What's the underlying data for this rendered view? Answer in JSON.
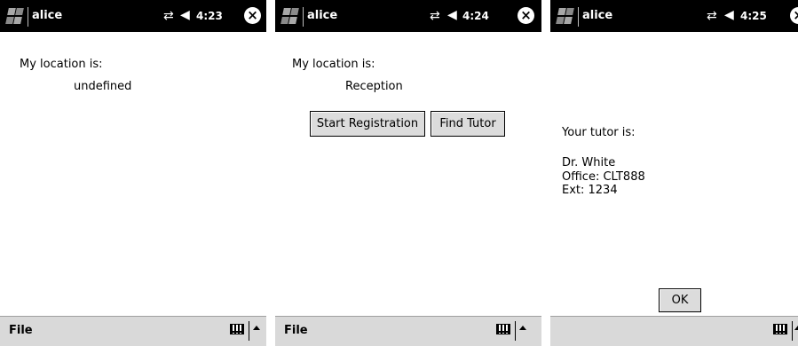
{
  "colors": {
    "titlebar": "#000000",
    "menubar": "#d9d9d9",
    "button_face": "#dcdcdc"
  },
  "screens": [
    {
      "titlebar": {
        "app_title": "alice",
        "time": "4:23",
        "icons": [
          "windows-logo-icon",
          "connectivity-icon",
          "speaker-icon",
          "close-icon"
        ]
      },
      "content": {
        "location_label": "My location is:",
        "location_value": "undefined"
      },
      "menubar": {
        "file_label": "File",
        "icons": [
          "keyboard-icon",
          "arrow-up-icon"
        ]
      }
    },
    {
      "titlebar": {
        "app_title": "alice",
        "time": "4:24",
        "icons": [
          "windows-logo-icon",
          "connectivity-icon",
          "speaker-icon",
          "close-icon"
        ]
      },
      "content": {
        "location_label": "My location is:",
        "location_value": "Reception",
        "start_registration_label": "Start Registration",
        "find_tutor_label": "Find Tutor"
      },
      "menubar": {
        "file_label": "File",
        "icons": [
          "keyboard-icon",
          "arrow-up-icon"
        ]
      }
    },
    {
      "titlebar": {
        "app_title": "alice",
        "time": "4:25",
        "icons": [
          "windows-logo-icon",
          "connectivity-icon",
          "speaker-icon",
          "close-icon"
        ]
      },
      "content": {
        "tutor_label": "Your tutor is:",
        "tutor_name": "Dr. White",
        "tutor_office": "Office: CLT888",
        "tutor_ext": "Ext: 1234",
        "ok_label": "OK"
      },
      "menubar": {
        "icons": [
          "keyboard-icon",
          "arrow-up-icon"
        ]
      }
    }
  ]
}
